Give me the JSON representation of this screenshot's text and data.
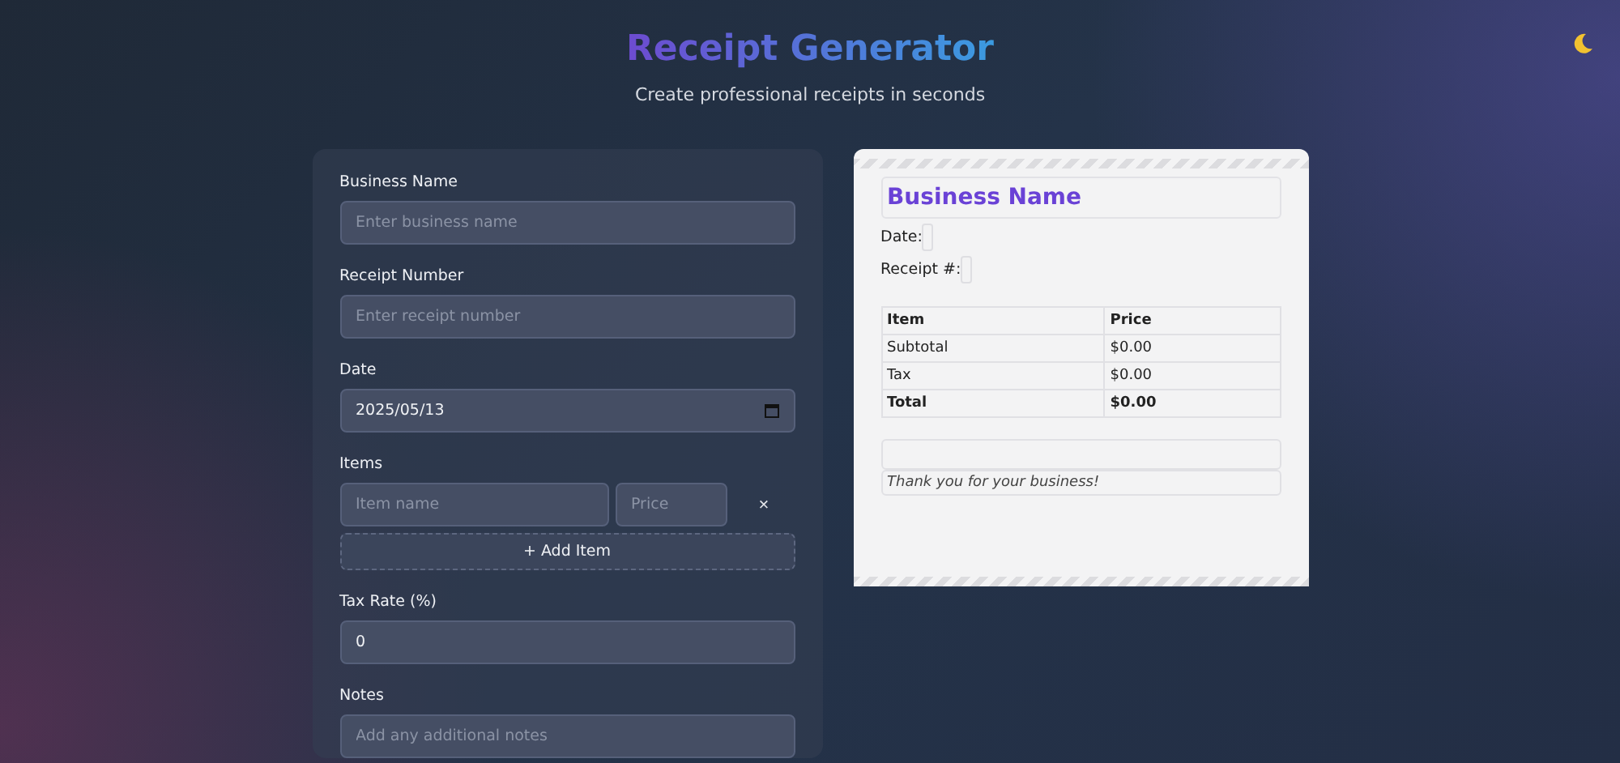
{
  "header": {
    "title": "Receipt Generator",
    "subtitle": "Create professional receipts in seconds"
  },
  "form": {
    "business_name": {
      "label": "Business Name",
      "placeholder": "Enter business name"
    },
    "receipt_number": {
      "label": "Receipt Number",
      "placeholder": "Enter receipt number"
    },
    "date": {
      "label": "Date",
      "value": "2025/05/13"
    },
    "items": {
      "label": "Items",
      "rows": [
        {
          "name_placeholder": "Item name",
          "price_placeholder": "Price",
          "remove": "×"
        }
      ],
      "add_button": "+ Add Item"
    },
    "tax_rate": {
      "label": "Tax Rate (%)",
      "value": "0"
    },
    "notes": {
      "label": "Notes",
      "placeholder": "Add any additional notes"
    }
  },
  "receipt": {
    "business_name": "Business Name",
    "date_label": "Date:",
    "receipt_label": "Receipt #:",
    "columns": [
      "Item",
      "Price"
    ],
    "rows": [
      {
        "kind": "line",
        "cells": [
          "Subtotal",
          "$0.00"
        ]
      },
      {
        "kind": "line",
        "cells": [
          "Tax",
          "$0.00"
        ]
      },
      {
        "kind": "total",
        "cells": [
          "Total",
          "$0.00"
        ]
      }
    ],
    "footer": "Thank you for your business!"
  }
}
